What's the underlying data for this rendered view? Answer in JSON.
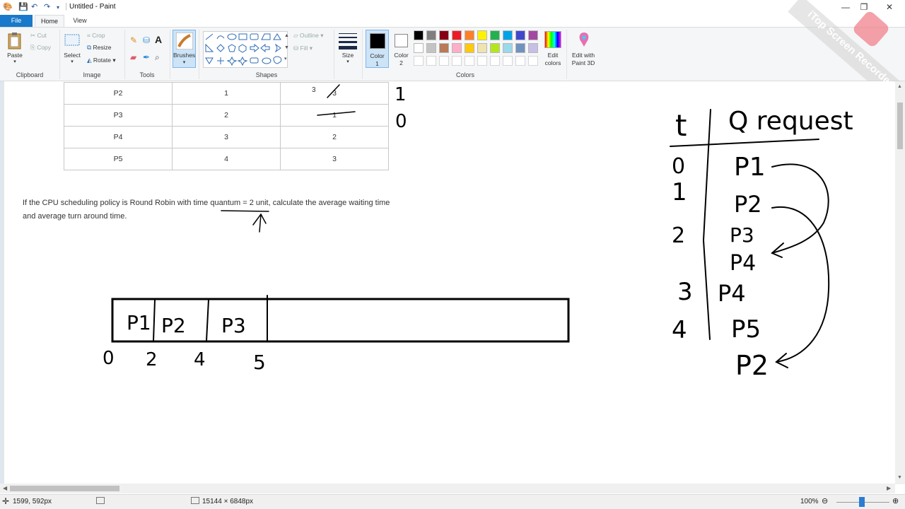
{
  "window": {
    "title": "Untitled - Paint",
    "watermark": "iTop Screen Recorder"
  },
  "tabs": [
    {
      "label": "File"
    },
    {
      "label": "Home"
    },
    {
      "label": "View"
    }
  ],
  "ribbon": {
    "clipboard": {
      "paste": "Paste",
      "cut": "Cut",
      "copy": "Copy",
      "group": "Clipboard"
    },
    "image": {
      "select": "Select",
      "crop": "Crop",
      "resize": "Resize",
      "rotate": "Rotate",
      "group": "Image"
    },
    "tools": {
      "group": "Tools"
    },
    "brushes": {
      "label": "Brushes"
    },
    "shapes": {
      "outline": "Outline",
      "fill": "Fill",
      "group": "Shapes"
    },
    "size": {
      "label": "Size"
    },
    "color1": {
      "label": "Color",
      "index": "1"
    },
    "color2": {
      "label": "Color",
      "index": "2"
    },
    "colors": {
      "group": "Colors",
      "edit": "Edit colors",
      "paint3d": "Edit with Paint 3D"
    },
    "palette_row1": [
      "#000000",
      "#7f7f7f",
      "#880015",
      "#ed1c24",
      "#ff7f27",
      "#fff200",
      "#22b14c",
      "#00a2e8",
      "#3f48cc",
      "#a349a4"
    ],
    "palette_row2": [
      "#ffffff",
      "#c3c3c3",
      "#b97a57",
      "#ffaec9",
      "#ffc90e",
      "#efe4b0",
      "#b5e61d",
      "#99d9ea",
      "#7092be",
      "#c8bfe7"
    ]
  },
  "canvas": {
    "table": [
      {
        "process": "P2",
        "arrival": "1",
        "burst": "3"
      },
      {
        "process": "P3",
        "arrival": "2",
        "burst": "1"
      },
      {
        "process": "P4",
        "arrival": "3",
        "burst": "2"
      },
      {
        "process": "P5",
        "arrival": "4",
        "burst": "3"
      }
    ],
    "question_line1": "If the CPU scheduling policy is Round Robin with time quantum = 2 unit, calculate the average waiting time",
    "question_line2": "and average turn around time.",
    "gantt": {
      "slots": [
        "P1",
        "P2",
        "P3"
      ],
      "times": [
        "0",
        "2",
        "4",
        "5"
      ]
    },
    "side_notes": [
      "1",
      "0"
    ],
    "queue": {
      "header_t": "t",
      "header_q": "Q request",
      "times": [
        "0",
        "1",
        "2",
        "3",
        "4"
      ],
      "entries": [
        "P1",
        "P2",
        "P3",
        "P4",
        "P4",
        "P5",
        "P2"
      ]
    }
  },
  "status": {
    "cursor": "1599, 592px",
    "canvas_size": "15144 × 6848px",
    "zoom": "100%"
  }
}
